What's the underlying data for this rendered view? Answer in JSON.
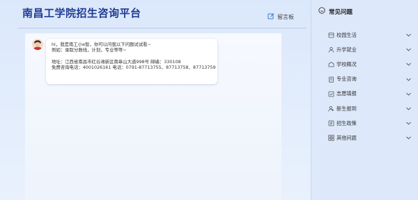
{
  "header": {
    "title": "南昌工学院招生咨询平台",
    "guestbook_label": "留言板",
    "guestbook_icon": "edit-icon"
  },
  "chat": {
    "avatar_icon": "avatar-icon",
    "message_lines": [
      "hi，我是南工小e智，你可以问我以下问题试试看~",
      "例如：录取分数线，计划，专业等等~",
      "",
      "地址：江西省南昌市红谷滩新区南皋山大道998号     邮编：330108",
      "免费咨询电话：4001026161 电话：0791-87713755、87713758、87713759"
    ]
  },
  "sidebar": {
    "title": "常见问题",
    "title_icon": "question-circle-icon",
    "items": [
      {
        "label": "校园生活",
        "icon": "campus-life-icon"
      },
      {
        "label": "升学就业",
        "icon": "career-icon"
      },
      {
        "label": "学校概况",
        "icon": "school-overview-icon"
      },
      {
        "label": "专业咨询",
        "icon": "major-icon"
      },
      {
        "label": "志愿填报",
        "icon": "application-icon"
      },
      {
        "label": "新生报到",
        "icon": "new-student-icon"
      },
      {
        "label": "招生政策",
        "icon": "policy-icon"
      },
      {
        "label": "其他问题",
        "icon": "other-icon"
      }
    ]
  },
  "colors": {
    "title": "#1f3a93",
    "background": "#dbe8fb",
    "sidebar": "#dde9fb"
  }
}
